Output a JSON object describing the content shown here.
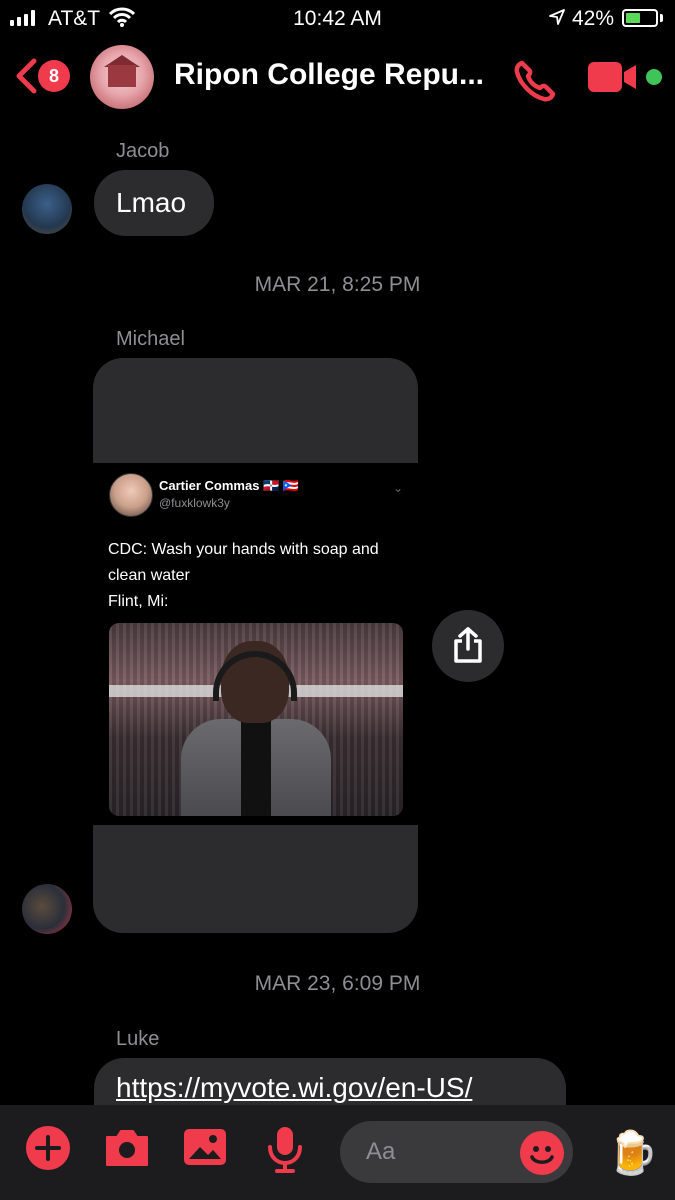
{
  "status_bar": {
    "carrier": "AT&T",
    "time": "10:42 AM",
    "battery_percent": "42%"
  },
  "header": {
    "back_badge_count": "8",
    "title": "Ripon College Repu...",
    "active_status": "online"
  },
  "messages": [
    {
      "sender": "Jacob",
      "text": "Lmao"
    },
    {
      "timestamp": "MAR 21, 8:25 PM"
    },
    {
      "sender": "Michael",
      "shared_tweet": {
        "author_name": "Cartier Commas",
        "author_flags": "🇩🇴 🇵🇷",
        "author_handle": "@fuxklowk3y",
        "text": "CDC: Wash your hands with soap and clean water",
        "text2": "Flint, Mi:"
      }
    },
    {
      "timestamp": "MAR 23, 6:09 PM"
    },
    {
      "sender": "Luke",
      "link": "https://myvote.wi.gov/en-US/"
    }
  ],
  "composer": {
    "placeholder": "Aa",
    "quick_reaction": "🍺"
  },
  "colors": {
    "accent": "#ef3b4c",
    "bubble": "#2c2c2e",
    "background": "#000000",
    "meta_text": "#8e8e93",
    "online": "#3fc45a"
  }
}
